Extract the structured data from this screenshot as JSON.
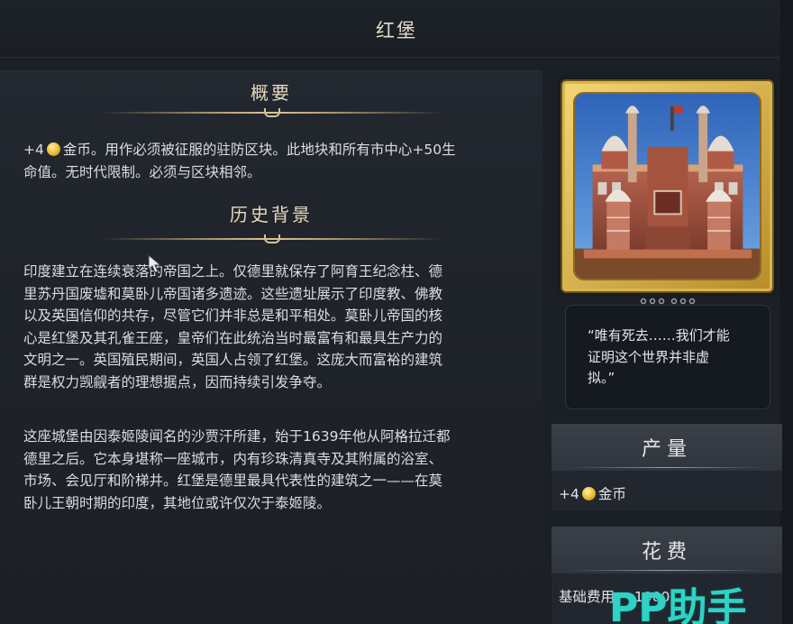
{
  "window": {
    "title": "红堡"
  },
  "overview": {
    "header": "概要",
    "line1_prefix": "+4",
    "line1_rest": "金币。用作必须被征服的驻防区块。此地块和所有市中心+50生",
    "line2": "命值。无时代限制。必须与区块相邻。"
  },
  "history": {
    "header": "历史背景",
    "paragraph1": [
      "印度建立在连续衰落的帝国之上。仅德里就保存了阿育王纪念柱、德",
      "里苏丹国废墟和莫卧儿帝国诸多遗迹。这些遗址展示了印度教、佛教",
      "以及英国信仰的共存，尽管它们并非总是和平相处。莫卧儿帝国的核",
      "心是红堡及其孔雀王座，皇帝们在此统治当时最富有和最具生产力的",
      "文明之一。英国殖民期间，英国人占领了红堡。这庞大而富裕的建筑",
      "群是权力觊觎者的理想据点，因而持续引发争夺。"
    ],
    "paragraph2": [
      "这座城堡由因泰姬陵闻名的沙贾汗所建，始于1639年他从阿格拉迁都",
      "德里之后。它本身堪称一座城市，内有珍珠清真寺及其附属的浴室、",
      "市场、会见厅和阶梯井。红堡是德里最具代表性的建筑之一——在莫",
      "卧儿王朝时期的印度，其地位或许仅次于泰姬陵。"
    ]
  },
  "quote": {
    "lines": [
      "“唯有死去……我们才能",
      "证明这个世界并非虚",
      "拟。”"
    ]
  },
  "production": {
    "header": "产量",
    "amount": "+4",
    "label": "金币"
  },
  "cost": {
    "header": "花费",
    "label": "基础费用",
    "value": "1000"
  },
  "watermark": {
    "text": "PP助手"
  },
  "icons": {
    "coin": "gold-coin-icon",
    "cursor": "mouse-cursor-icon",
    "wonder": "red-fort-wonder-image"
  },
  "colors": {
    "background": "#1b1f26",
    "header_gold": "#e8d9bb",
    "frame_gold": "#d8b64e",
    "watermark_teal": "#2ed3c6"
  }
}
